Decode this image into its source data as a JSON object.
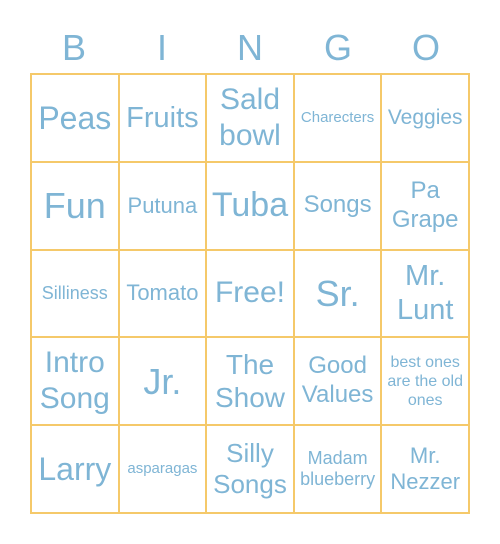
{
  "colors": {
    "text": "#7fb5d5",
    "border": "#f5c96a"
  },
  "header": [
    "B",
    "I",
    "N",
    "G",
    "O"
  ],
  "cells": [
    {
      "text": "Peas",
      "size": 32
    },
    {
      "text": "Fruits",
      "size": 29
    },
    {
      "text": "Sald bowl",
      "size": 30
    },
    {
      "text": "Charecters",
      "size": 15
    },
    {
      "text": "Veggies",
      "size": 21
    },
    {
      "text": "Fun",
      "size": 36
    },
    {
      "text": "Putuna",
      "size": 22
    },
    {
      "text": "Tuba",
      "size": 34
    },
    {
      "text": "Songs",
      "size": 24
    },
    {
      "text": "Pa Grape",
      "size": 24
    },
    {
      "text": "Silliness",
      "size": 18
    },
    {
      "text": "Tomato",
      "size": 22
    },
    {
      "text": "Free!",
      "size": 30
    },
    {
      "text": "Sr.",
      "size": 36
    },
    {
      "text": "Mr. Lunt",
      "size": 29
    },
    {
      "text": "Intro Song",
      "size": 30
    },
    {
      "text": "Jr.",
      "size": 36
    },
    {
      "text": "The Show",
      "size": 28
    },
    {
      "text": "Good Values",
      "size": 24
    },
    {
      "text": "best ones are the old ones",
      "size": 16
    },
    {
      "text": "Larry",
      "size": 32
    },
    {
      "text": "asparagas",
      "size": 15
    },
    {
      "text": "Silly Songs",
      "size": 26
    },
    {
      "text": "Madam blueberry",
      "size": 18
    },
    {
      "text": "Mr. Nezzer",
      "size": 22
    }
  ]
}
